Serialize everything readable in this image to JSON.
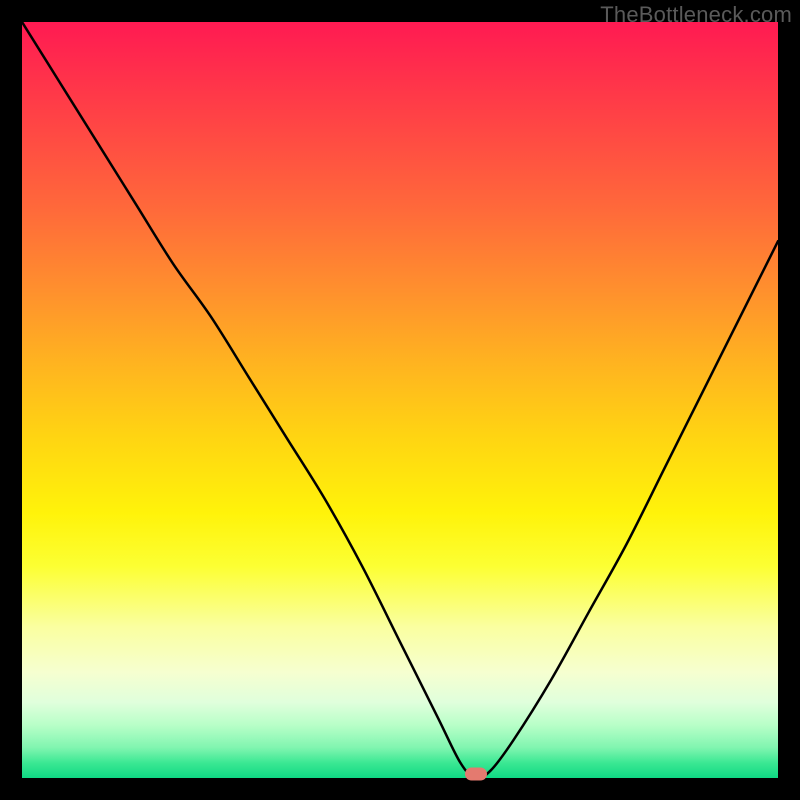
{
  "watermark": "TheBottleneck.com",
  "chart_data": {
    "type": "line",
    "title": "",
    "xlabel": "",
    "ylabel": "",
    "xlim": [
      0,
      100
    ],
    "ylim": [
      0,
      100
    ],
    "x": [
      0,
      5,
      10,
      15,
      20,
      25,
      30,
      35,
      40,
      45,
      50,
      55,
      58,
      60,
      62,
      65,
      70,
      75,
      80,
      85,
      90,
      95,
      100
    ],
    "values": [
      100,
      92,
      84,
      76,
      68,
      61,
      53,
      45,
      37,
      28,
      18,
      8,
      2,
      0,
      1,
      5,
      13,
      22,
      31,
      41,
      51,
      61,
      71
    ],
    "minimum_x": 60,
    "minimum_y": 0,
    "marker": {
      "x": 60,
      "y": 0
    },
    "grid": false,
    "legend": false,
    "colors": {
      "curve": "#000000",
      "marker": "#e47a6f",
      "gradient_top": "#ff1a52",
      "gradient_bottom": "#0fd884"
    }
  }
}
